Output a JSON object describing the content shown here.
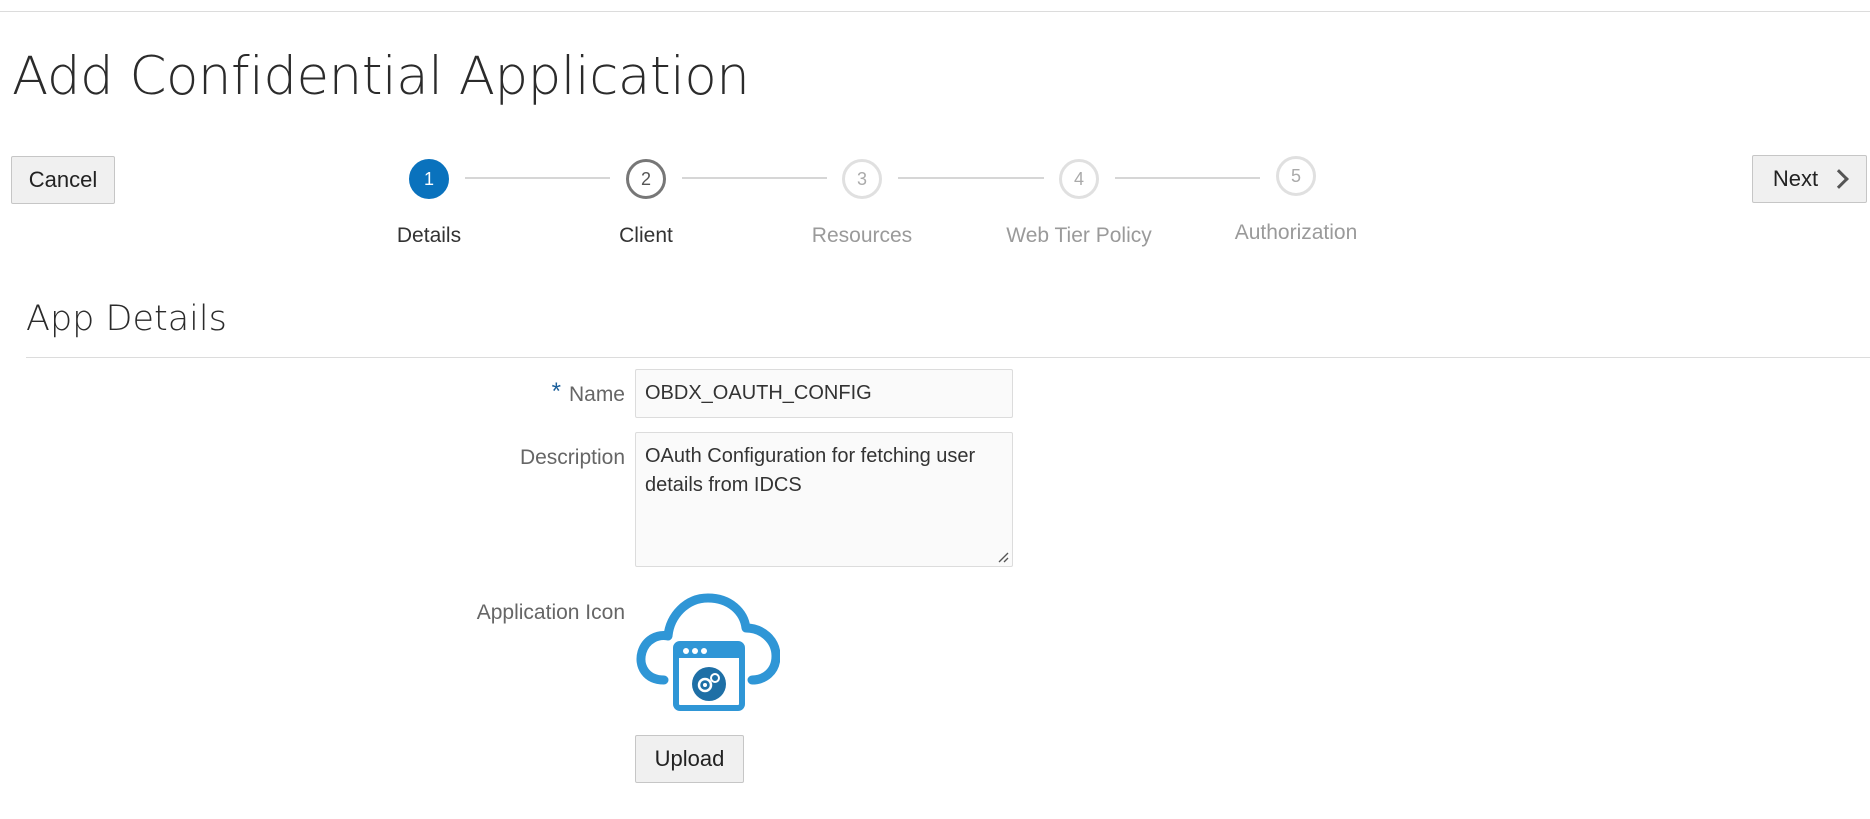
{
  "page": {
    "title": "Add Confidential Application"
  },
  "toolbar": {
    "cancel_label": "Cancel",
    "next_label": "Next"
  },
  "train": {
    "steps": [
      {
        "number": "1",
        "label": "Details",
        "state": "current"
      },
      {
        "number": "2",
        "label": "Client",
        "state": "visited"
      },
      {
        "number": "3",
        "label": "Resources",
        "state": "future"
      },
      {
        "number": "4",
        "label": "Web Tier Policy",
        "state": "future"
      },
      {
        "number": "5",
        "label": "Authorization",
        "state": "future"
      }
    ]
  },
  "section": {
    "title": "App Details"
  },
  "form": {
    "required_marker": "*",
    "name_label": "Name",
    "name_value": "OBDX_OAUTH_CONFIG",
    "description_label": "Description",
    "description_value": "OAuth Configuration for fetching user details from IDCS",
    "icon_label": "Application Icon",
    "icon_name": "cloud-application-icon",
    "upload_label": "Upload"
  },
  "colors": {
    "accent": "#0a72bd",
    "icon_blue": "#2f96d6",
    "icon_dark": "#1e6fa6"
  }
}
